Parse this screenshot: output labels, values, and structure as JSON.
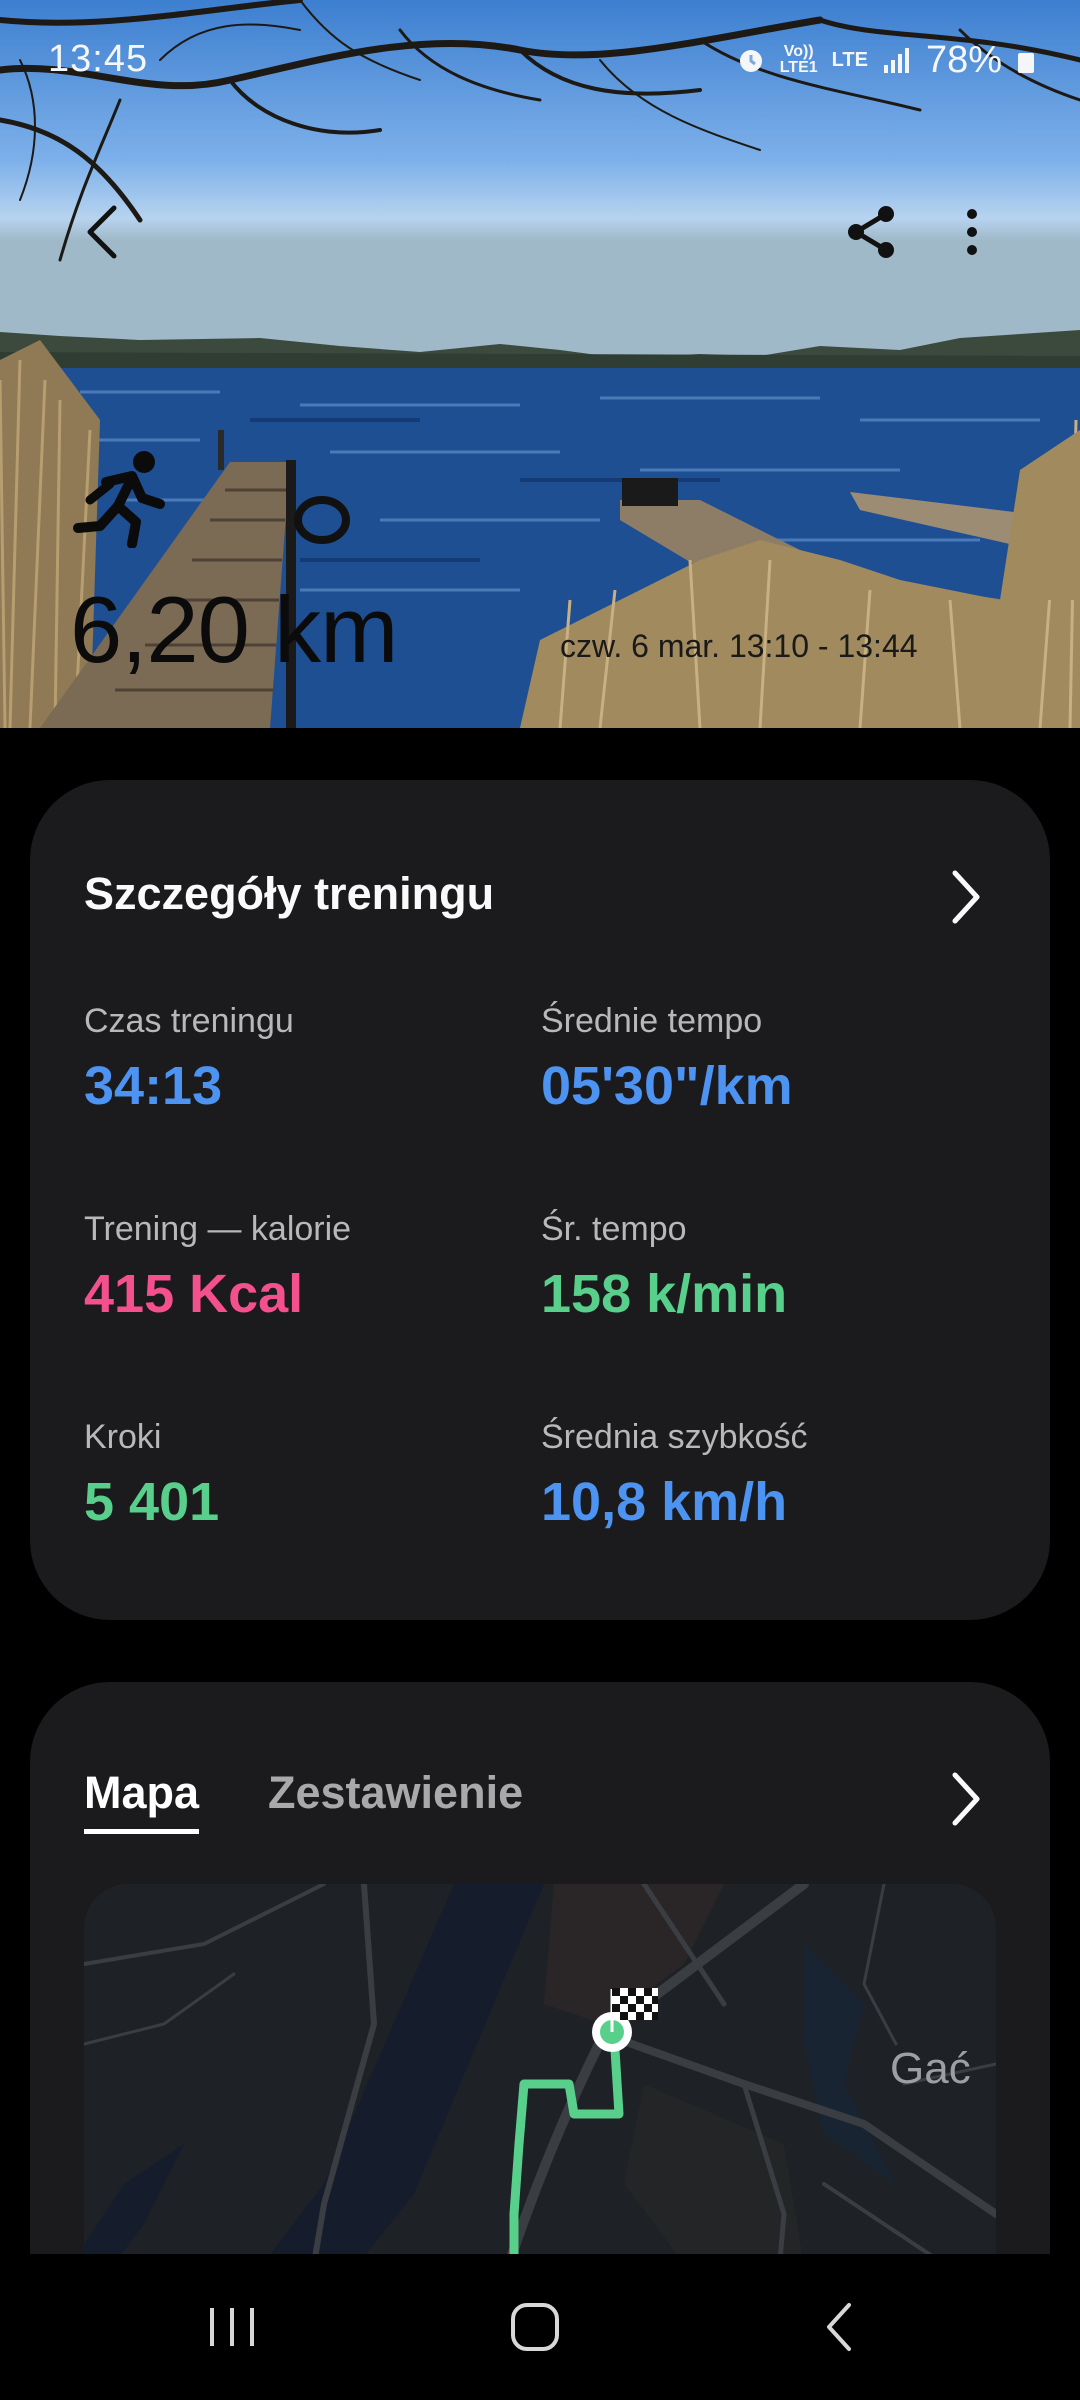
{
  "status_bar": {
    "time": "13:45",
    "volte": "Vo))",
    "lte_sub": "LTE1",
    "network": "LTE",
    "battery": "78%"
  },
  "header": {
    "activity_icon": "running-person-icon",
    "distance": "6,20 km",
    "datetime": "czw. 6 mar. 13:10 - 13:44"
  },
  "details": {
    "title": "Szczegóły treningu",
    "stats": [
      {
        "label": "Czas treningu",
        "value": "34:13",
        "color": "#4d93f2"
      },
      {
        "label": "Średnie tempo",
        "value": "05'30\"/km",
        "color": "#4d93f2"
      },
      {
        "label": "Trening — kalorie",
        "value": "415 Kcal",
        "color": "#f4508e"
      },
      {
        "label": "Śr. tempo",
        "value": "158 k/min",
        "color": "#58d08b"
      },
      {
        "label": "Kroki",
        "value": "5 401",
        "color": "#58d08b"
      },
      {
        "label": "Średnia szybkość",
        "value": "10,8 km/h",
        "color": "#4d93f2"
      }
    ]
  },
  "map_card": {
    "tabs": [
      {
        "label": "Mapa",
        "active": true
      },
      {
        "label": "Zestawienie",
        "active": false
      }
    ],
    "place_label": "Gać",
    "route_color": "#58d08b"
  },
  "colors": {
    "accent_blue": "#4d93f2",
    "accent_pink": "#f4508e",
    "accent_green": "#58d08b",
    "card_bg": "#1b1b1d"
  }
}
